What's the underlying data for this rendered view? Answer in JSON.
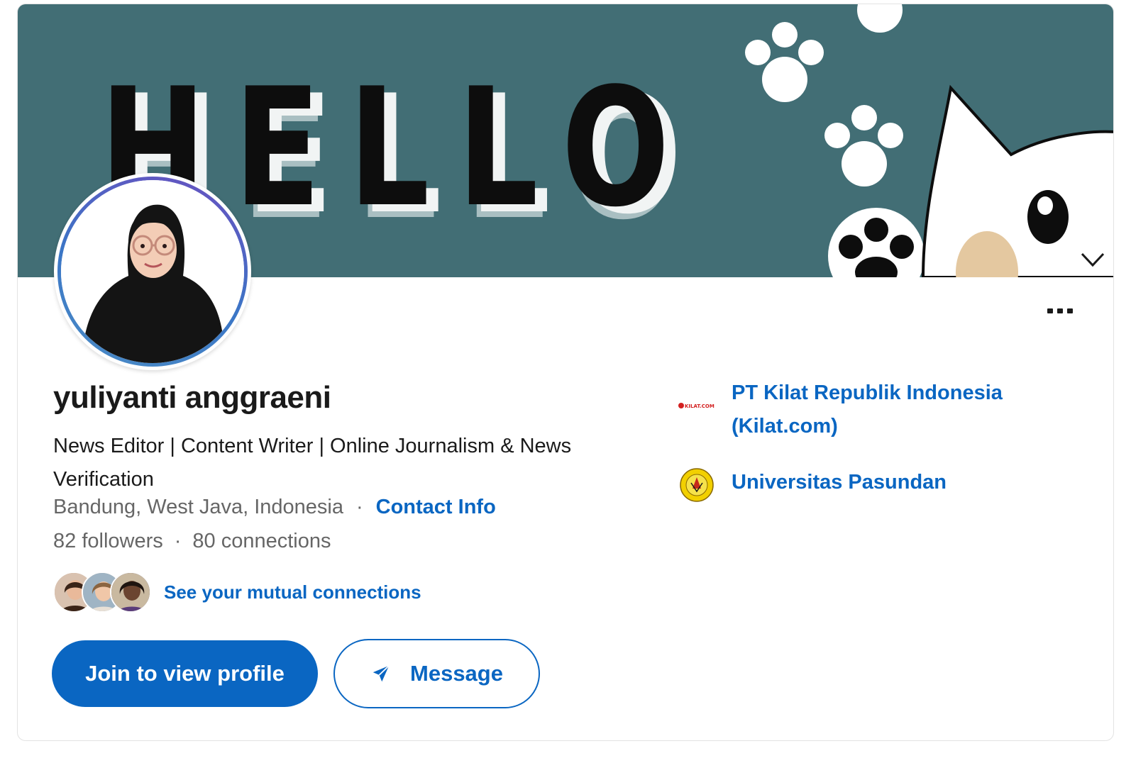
{
  "banner": {
    "text": "HELLO",
    "bg_color": "#426e75"
  },
  "profile": {
    "name": "yuliyanti anggraeni",
    "headline": "News Editor | Content Writer | Online Journalism & News Verification",
    "location": "Bandung, West Java, Indonesia",
    "contact_info_label": "Contact Info",
    "followers": "82 followers",
    "connections": "80 connections",
    "separator": "·"
  },
  "mutual": {
    "link_label": "See your mutual connections"
  },
  "actions": {
    "join_label": "Join to view profile",
    "message_label": "Message",
    "more_icon": "more-horizontal-icon"
  },
  "organizations": [
    {
      "name": "PT Kilat Republik Indonesia (Kilat.com)",
      "logo_text": "KILAT.COM"
    },
    {
      "name": "Universitas Pasundan",
      "logo_text": "UNIVERSITAS PASUNDAN"
    }
  ],
  "colors": {
    "accent": "#0a66c2",
    "muted_text": "#666666",
    "primary_text": "#1a1a1a"
  }
}
